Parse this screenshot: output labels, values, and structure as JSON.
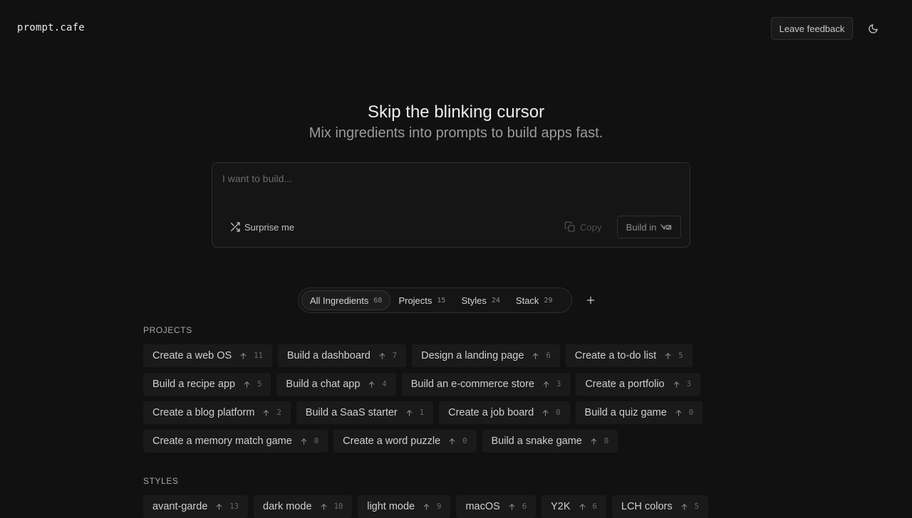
{
  "header": {
    "logo": "prompt.cafe",
    "feedback_label": "Leave feedback",
    "theme_icon": "moon-icon"
  },
  "hero": {
    "title": "Skip the blinking cursor",
    "subtitle": "Mix ingredients into prompts to build apps fast."
  },
  "prompt": {
    "placeholder": "I want to build...",
    "value": "",
    "surprise_label": "Surprise me",
    "copy_label": "Copy",
    "build_label": "Build in"
  },
  "tabs": [
    {
      "label": "All Ingredients",
      "count": "68",
      "active": true
    },
    {
      "label": "Projects",
      "count": "15",
      "active": false
    },
    {
      "label": "Styles",
      "count": "24",
      "active": false
    },
    {
      "label": "Stack",
      "count": "29",
      "active": false
    }
  ],
  "sections": {
    "projects": {
      "label": "PROJECTS",
      "rows": [
        [
          {
            "label": "Create a web OS",
            "votes": "11"
          },
          {
            "label": "Build a dashboard",
            "votes": "7"
          },
          {
            "label": "Design a landing page",
            "votes": "6"
          },
          {
            "label": "Create a to-do list",
            "votes": "5"
          }
        ],
        [
          {
            "label": "Build a recipe app",
            "votes": "5"
          },
          {
            "label": "Build a chat app",
            "votes": "4"
          },
          {
            "label": "Build an e-commerce store",
            "votes": "3"
          },
          {
            "label": "Create a portfolio",
            "votes": "3"
          }
        ],
        [
          {
            "label": "Create a blog platform",
            "votes": "2"
          },
          {
            "label": "Build a SaaS starter",
            "votes": "1"
          },
          {
            "label": "Create a job board",
            "votes": "0"
          },
          {
            "label": "Build a quiz game",
            "votes": "0"
          }
        ],
        [
          {
            "label": "Create a memory match game",
            "votes": "0"
          },
          {
            "label": "Create a word puzzle",
            "votes": "0"
          },
          {
            "label": "Build a snake game",
            "votes": "0"
          }
        ]
      ]
    },
    "styles": {
      "label": "STYLES",
      "rows": [
        [
          {
            "label": "avant-garde",
            "votes": "13"
          },
          {
            "label": "dark mode",
            "votes": "10"
          },
          {
            "label": "light mode",
            "votes": "9"
          },
          {
            "label": "macOS",
            "votes": "6"
          },
          {
            "label": "Y2K",
            "votes": "6"
          },
          {
            "label": "LCH colors",
            "votes": "5"
          }
        ]
      ]
    }
  },
  "colors": {
    "background": "#111111",
    "chip": "#1a1a1a",
    "text": "#cfcfcf",
    "muted": "#6a6a6a"
  }
}
